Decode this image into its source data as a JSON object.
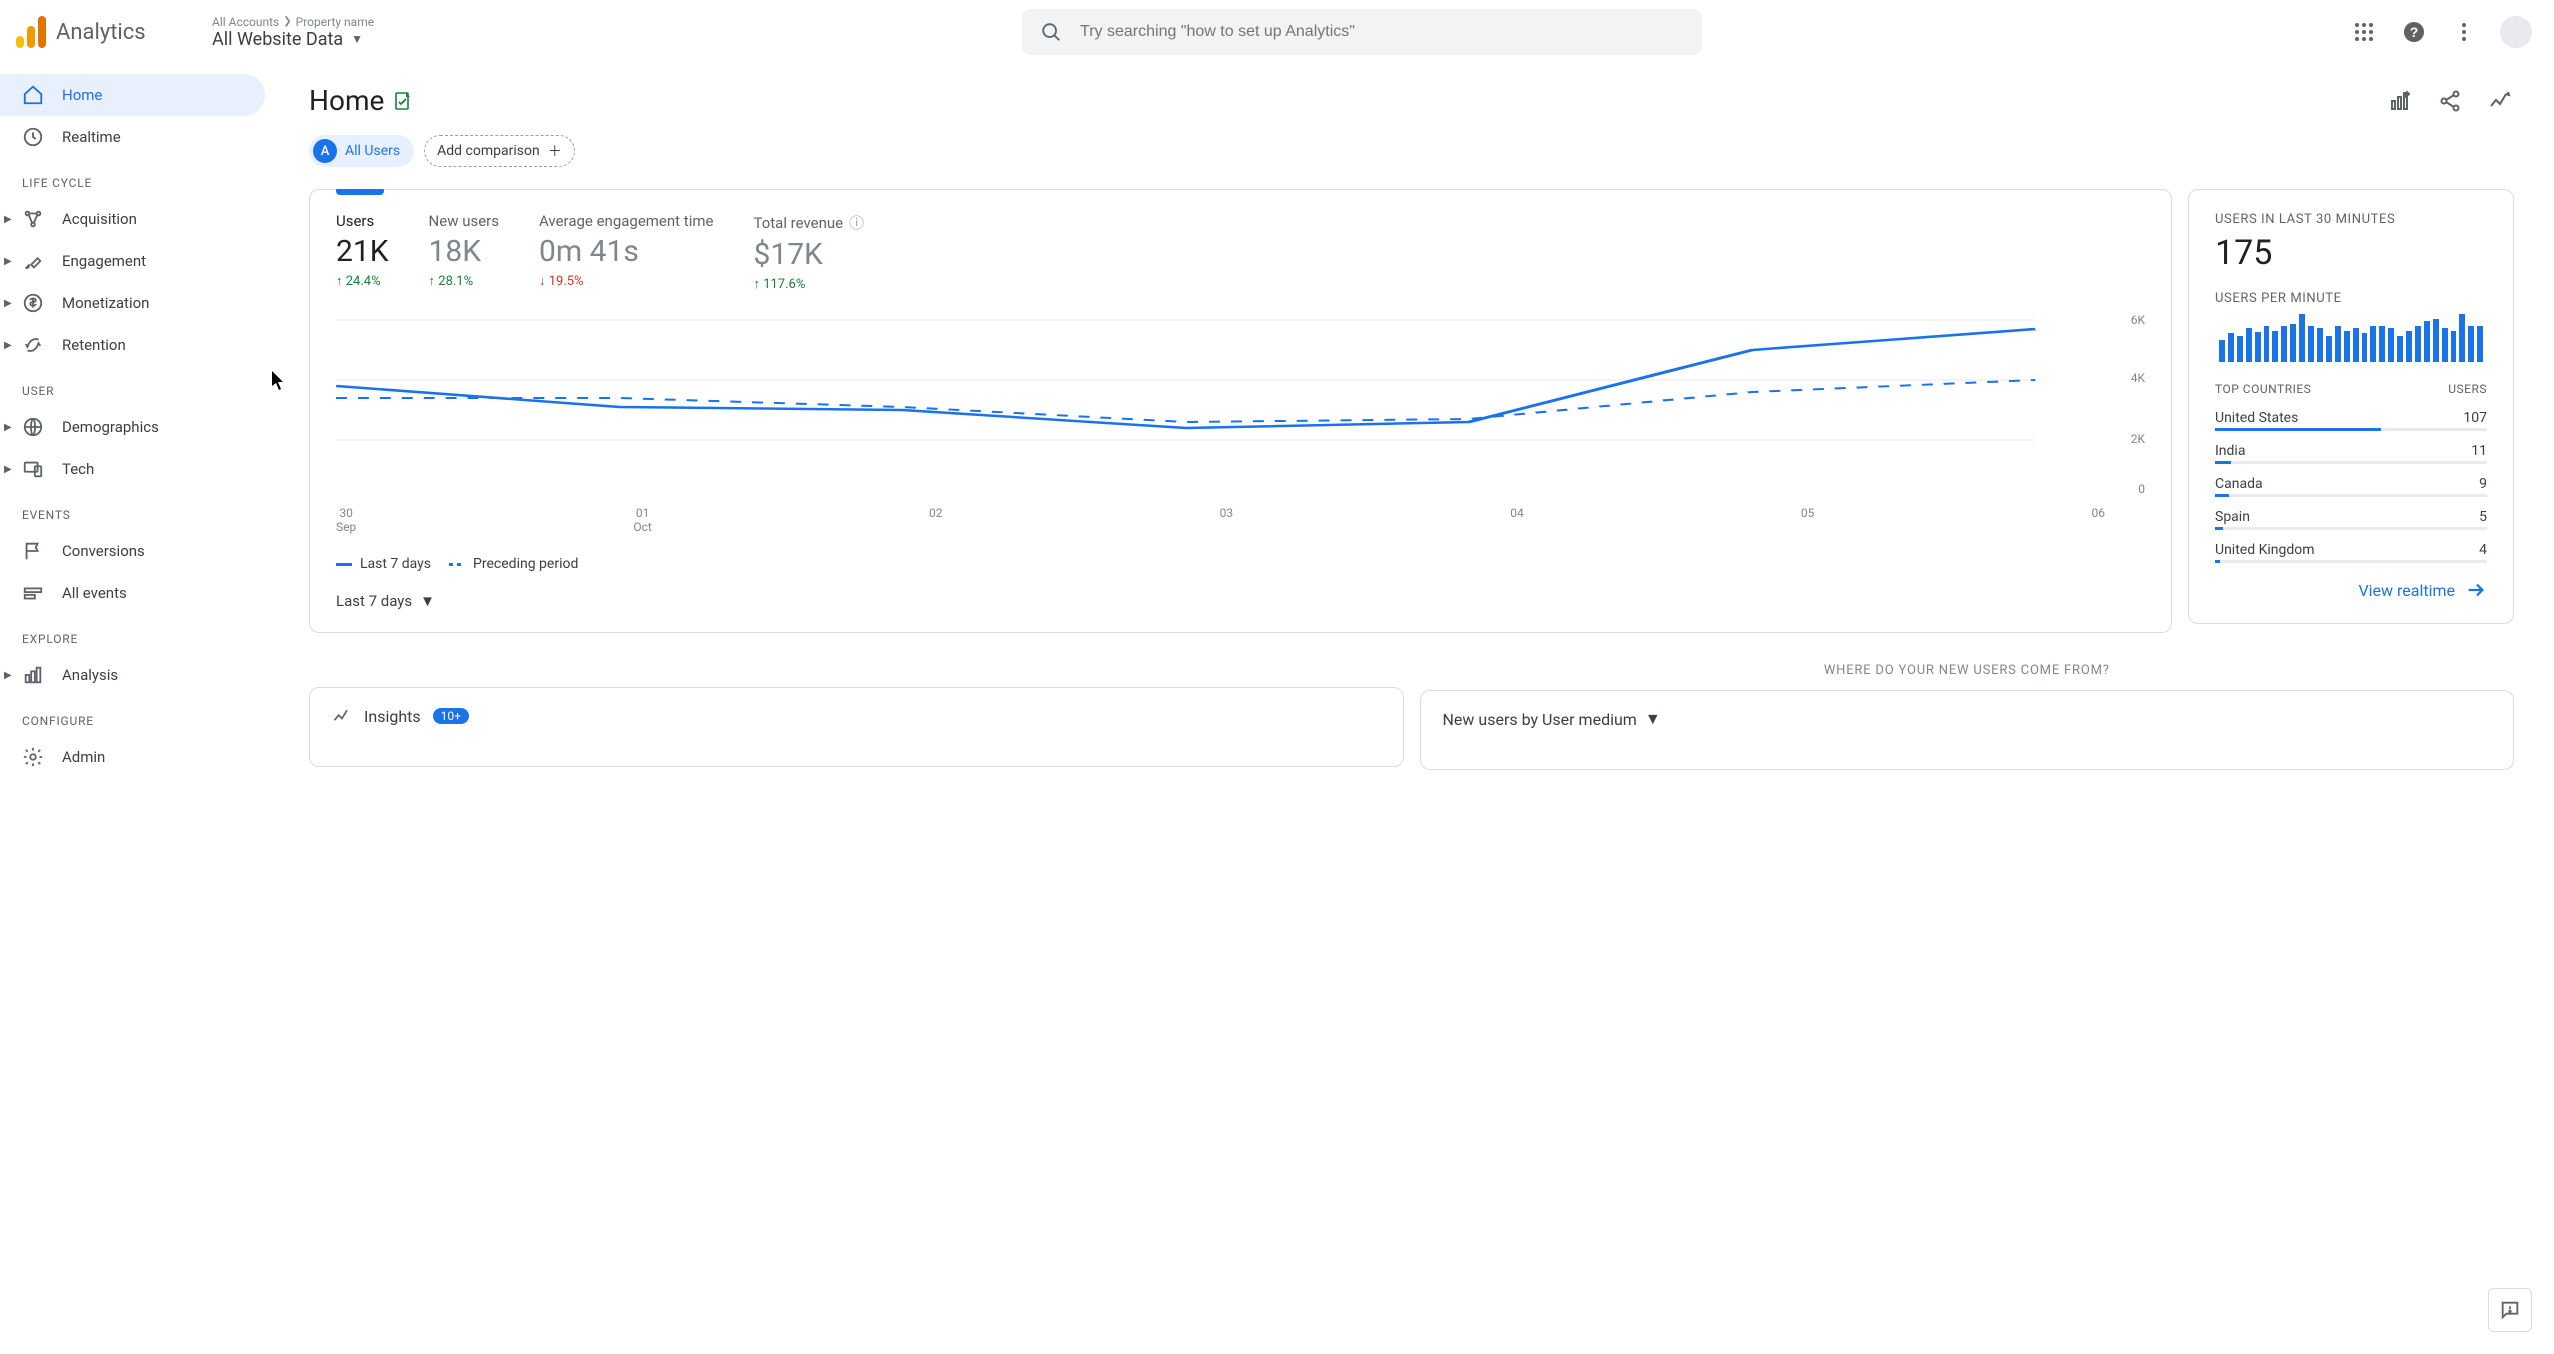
{
  "header": {
    "product": "Analytics",
    "breadcrumb_accounts": "All Accounts",
    "breadcrumb_property": "Property name",
    "breadcrumb_main": "All Website Data",
    "search_placeholder": "Try searching \"how to set up Analytics\""
  },
  "sidebar": {
    "home": "Home",
    "realtime": "Realtime",
    "section_lifecycle": "LIFE CYCLE",
    "acquisition": "Acquisition",
    "engagement": "Engagement",
    "monetization": "Monetization",
    "retention": "Retention",
    "section_user": "USER",
    "demographics": "Demographics",
    "tech": "Tech",
    "section_events": "EVENTS",
    "conversions": "Conversions",
    "all_events": "All events",
    "section_explore": "EXPLORE",
    "analysis": "Analysis",
    "section_configure": "CONFIGURE",
    "admin": "Admin"
  },
  "page": {
    "title": "Home",
    "segment_all_users": "All Users",
    "segment_badge": "A",
    "add_comparison": "Add comparison"
  },
  "overview": {
    "metrics": [
      {
        "label": "Users",
        "value": "21K",
        "delta": "24.4%",
        "dir": "up"
      },
      {
        "label": "New users",
        "value": "18K",
        "delta": "28.1%",
        "dir": "up"
      },
      {
        "label": "Average engagement time",
        "value": "0m 41s",
        "delta": "19.5%",
        "dir": "down"
      },
      {
        "label": "Total revenue",
        "value": "$17K",
        "delta": "117.6%",
        "dir": "up"
      }
    ],
    "legend_current": "Last 7 days",
    "legend_prev": "Preceding period",
    "date_range": "Last 7 days",
    "y_ticks": [
      "6K",
      "4K",
      "2K",
      "0"
    ],
    "x_ticks": [
      {
        "d": "30",
        "m": "Sep"
      },
      {
        "d": "01",
        "m": "Oct"
      },
      {
        "d": "02",
        "m": ""
      },
      {
        "d": "03",
        "m": ""
      },
      {
        "d": "04",
        "m": ""
      },
      {
        "d": "05",
        "m": ""
      },
      {
        "d": "06",
        "m": ""
      }
    ]
  },
  "chart_data": {
    "type": "line",
    "title": "Users — Last 7 days vs Preceding period",
    "xlabel": "",
    "ylabel": "Users",
    "ylim": [
      0,
      6000
    ],
    "x": [
      "30 Sep",
      "01 Oct",
      "02",
      "03",
      "04",
      "05",
      "06"
    ],
    "series": [
      {
        "name": "Last 7 days",
        "values": [
          3800,
          3100,
          3000,
          2400,
          2600,
          5000,
          5700
        ]
      },
      {
        "name": "Preceding period",
        "values": [
          3400,
          3400,
          3100,
          2600,
          2700,
          3600,
          4000
        ]
      }
    ]
  },
  "realtime": {
    "title": "USERS IN LAST 30 MINUTES",
    "big": "175",
    "sub": "USERS PER MINUTE",
    "spark": [
      18,
      24,
      22,
      28,
      25,
      30,
      26,
      30,
      32,
      40,
      30,
      28,
      22,
      30,
      26,
      28,
      24,
      30,
      30,
      28,
      22,
      26,
      30,
      34,
      36,
      28,
      26,
      40,
      30,
      30
    ],
    "countries_label": "TOP COUNTRIES",
    "users_label": "USERS",
    "countries": [
      {
        "name": "United States",
        "users": "107",
        "pct": 61
      },
      {
        "name": "India",
        "users": "11",
        "pct": 6
      },
      {
        "name": "Canada",
        "users": "9",
        "pct": 5
      },
      {
        "name": "Spain",
        "users": "5",
        "pct": 3
      },
      {
        "name": "United Kingdom",
        "users": "4",
        "pct": 2
      }
    ],
    "view": "View realtime"
  },
  "section2": {
    "where_title": "WHERE DO YOUR NEW USERS COME FROM?",
    "insights_label": "Insights",
    "insights_count": "10+",
    "medium_label": "New users by User medium"
  }
}
